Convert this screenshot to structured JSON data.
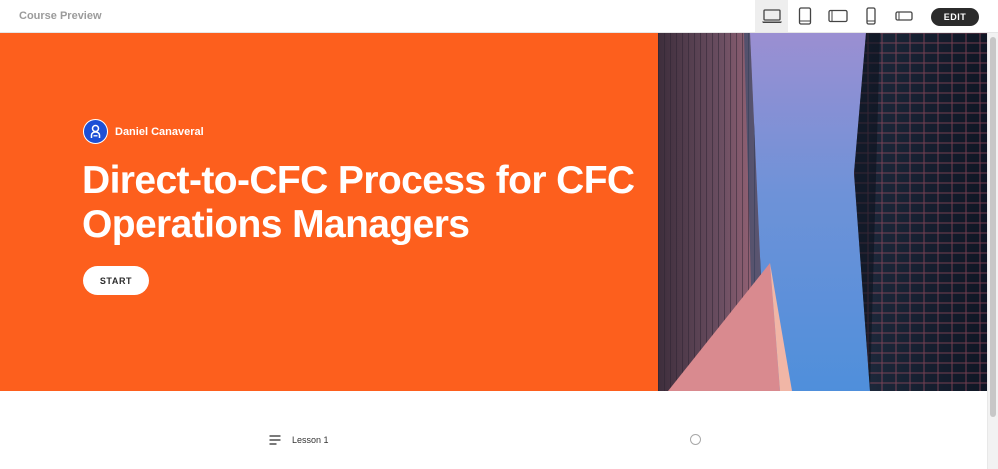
{
  "app": {
    "title": "Course Preview"
  },
  "toolbar": {
    "devices": [
      {
        "name": "laptop-icon",
        "active": true
      },
      {
        "name": "tablet-portrait-icon",
        "active": false
      },
      {
        "name": "tablet-landscape-icon",
        "active": false
      },
      {
        "name": "phone-portrait-icon",
        "active": false
      },
      {
        "name": "phone-landscape-icon",
        "active": false
      }
    ],
    "edit_label": "EDIT"
  },
  "hero": {
    "author": "Daniel Canaveral",
    "title": "Direct-to-CFC Process for CFC Operations Managers",
    "start_label": "START",
    "image": "building-photo"
  },
  "lessons": [
    {
      "label": "Lesson 1",
      "status": "incomplete"
    }
  ],
  "colors": {
    "accent": "#fd5f1d",
    "edit_button": "#2b2b2b",
    "avatar": "#1c4fd6"
  }
}
